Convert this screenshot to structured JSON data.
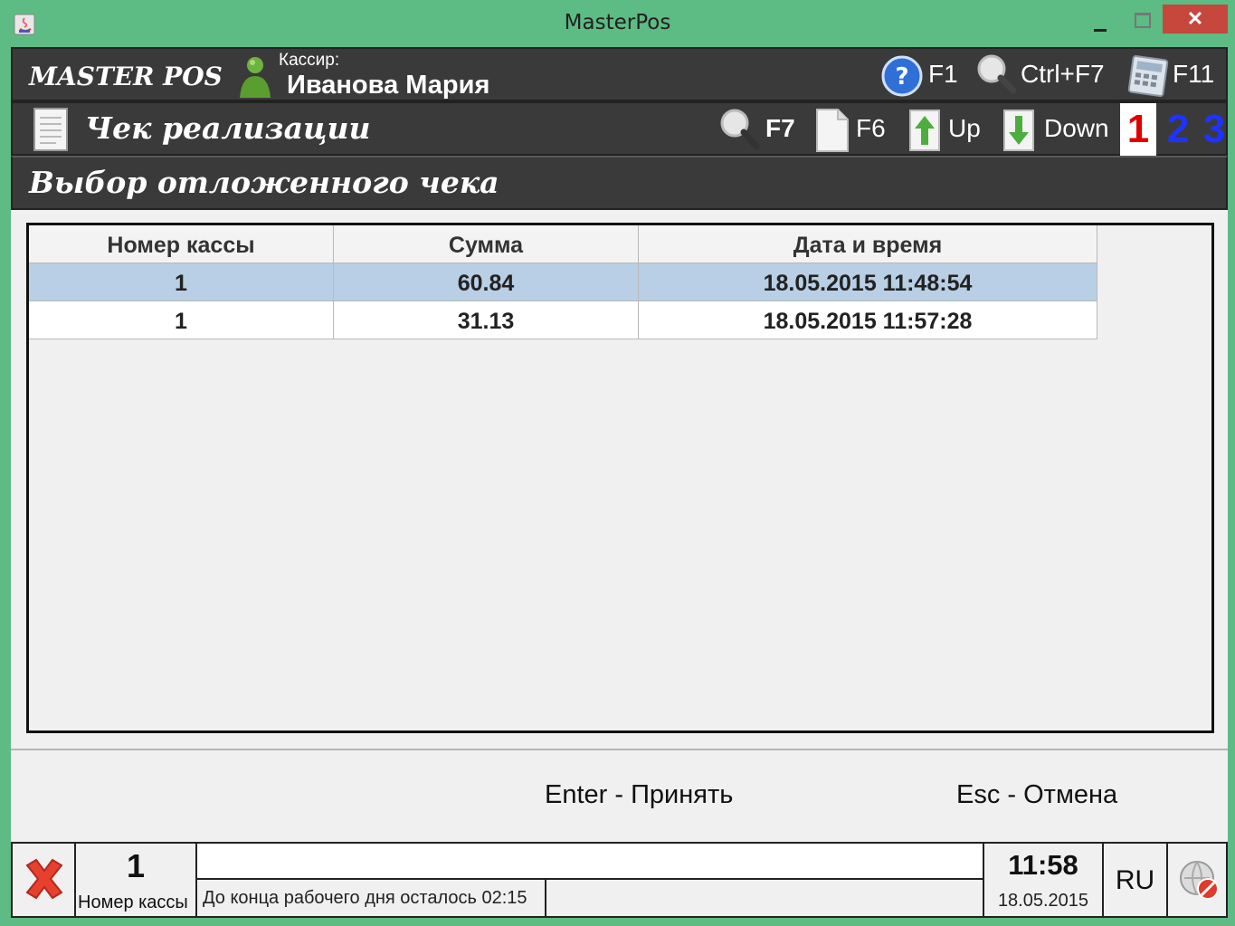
{
  "window": {
    "title": "MasterPos",
    "close_glyph": "✕"
  },
  "header": {
    "brand": "MASTER POS",
    "cashier_label": "Кассир:",
    "cashier_name": "Иванова Мария",
    "hotkeys_top": {
      "help": "F1",
      "search": "Ctrl+F7",
      "calculator": "F11"
    },
    "receipt_title": "Чек реализации",
    "hotkeys_second": {
      "search": "F7",
      "new_doc": "F6",
      "up": "Up",
      "down": "Down"
    },
    "pages": [
      "1",
      "2",
      "3"
    ],
    "section_title": "Выбор отложенного чека"
  },
  "table": {
    "columns": [
      "Номер кассы",
      "Сумма",
      "Дата и время"
    ],
    "rows": [
      {
        "register": "1",
        "sum": "60.84",
        "datetime": "18.05.2015 11:48:54",
        "selected": true
      },
      {
        "register": "1",
        "sum": "31.13",
        "datetime": "18.05.2015 11:57:28",
        "selected": false
      }
    ]
  },
  "footer": {
    "enter_hint": "Enter - Принять",
    "esc_hint": "Esc - Отмена"
  },
  "status": {
    "register_number": "1",
    "register_label": "Номер кассы",
    "message": "До конца рабочего дня осталось 02:15",
    "time": "11:58",
    "date": "18.05.2015",
    "language": "RU"
  },
  "colors": {
    "window_frame": "#5dbb84",
    "header_bg": "#3a3a3a",
    "selected_row": "#b8cfe5",
    "page_active": "#e00000",
    "page_inactive": "#1f33ff",
    "close_button": "#c6473c"
  },
  "icons": [
    "java-app-icon",
    "cashier-icon",
    "help-icon",
    "search-icon",
    "calculator-icon",
    "document-icon",
    "search-icon",
    "new-document-icon",
    "arrow-up-icon",
    "arrow-down-icon",
    "close-x-icon",
    "network-disconnected-icon"
  ]
}
